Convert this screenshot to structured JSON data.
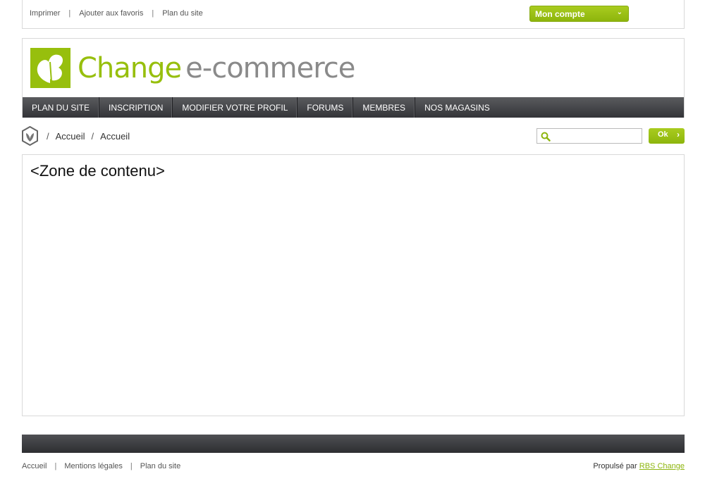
{
  "topbar": {
    "links": [
      "Imprimer",
      "Ajouter aux favoris",
      "Plan du site"
    ],
    "separator": "|",
    "account_label": "Mon compte"
  },
  "header": {
    "logo_part1": "Change",
    "logo_part2": "e-commerce",
    "brand_color": "#97bf0d"
  },
  "nav": {
    "items": [
      "PLAN DU SITE",
      "INSCRIPTION",
      "MODIFIER VOTRE PROFIL",
      "FORUMS",
      "MEMBRES",
      "NOS MAGASINS"
    ]
  },
  "breadcrumb": {
    "separator": "/",
    "items": [
      "Accueil",
      "Accueil"
    ]
  },
  "search": {
    "placeholder": "",
    "button_label": "Ok"
  },
  "content": {
    "heading": "<Zone de contenu>"
  },
  "footer": {
    "links": [
      "Accueil",
      "Mentions légales",
      "Plan du site"
    ],
    "separator": "|",
    "powered_prefix": "Propulsé par",
    "powered_link": "RBS Change"
  }
}
